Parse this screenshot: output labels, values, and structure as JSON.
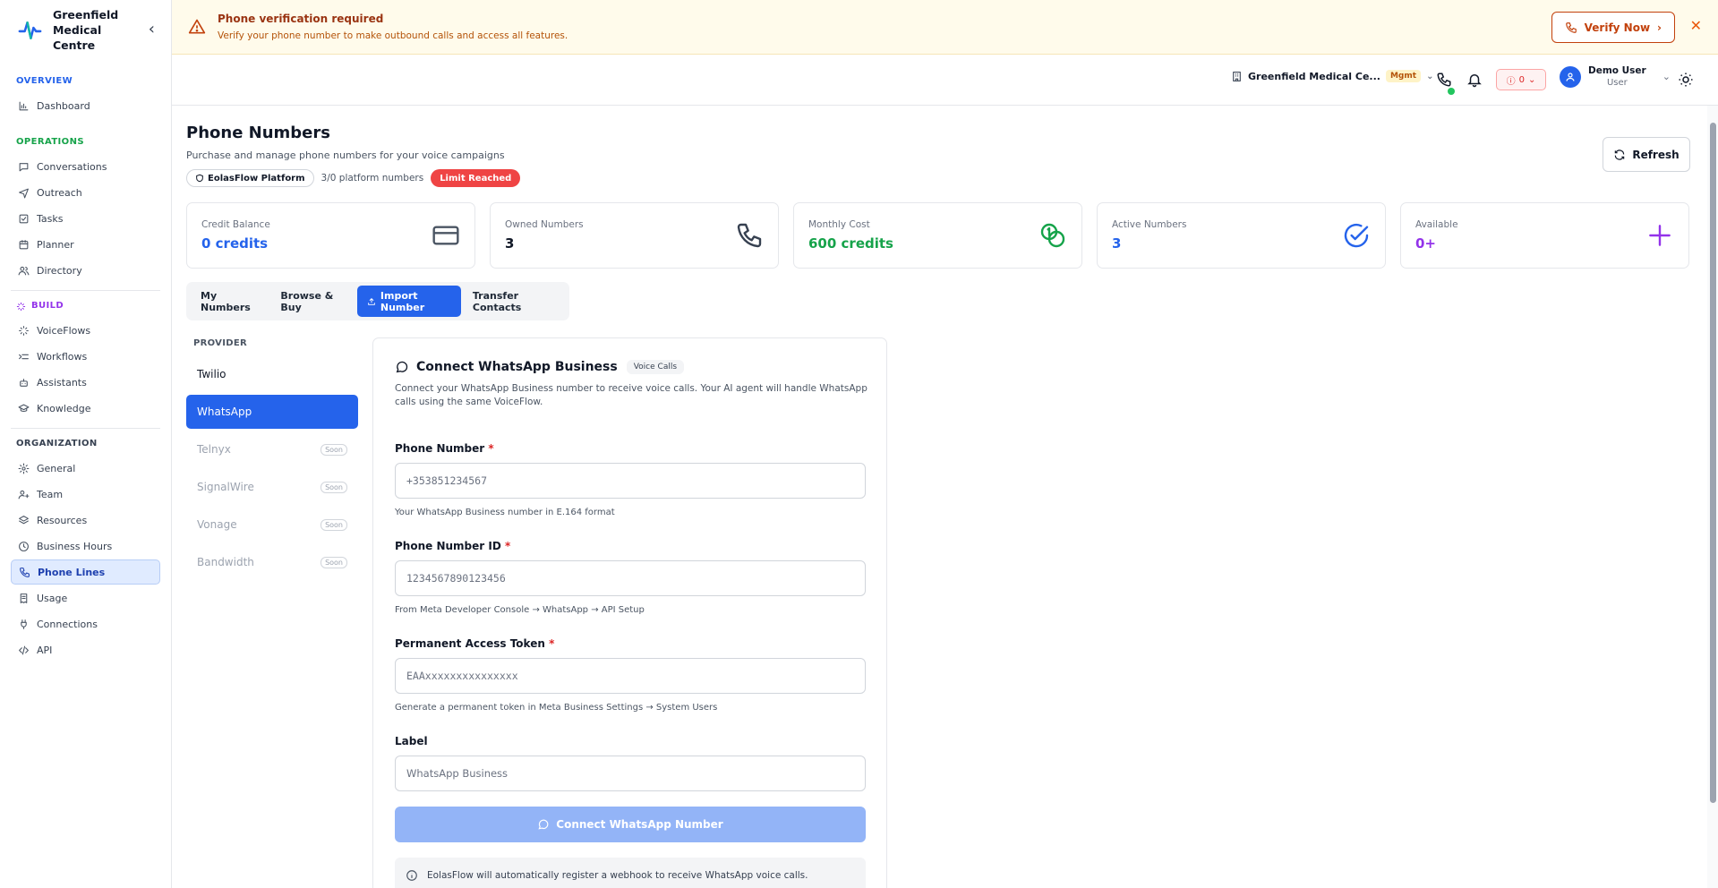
{
  "brand": {
    "name": "Greenfield Medical Centre"
  },
  "sidebar": {
    "sections": [
      {
        "label": "OVERVIEW",
        "color": "#2563eb",
        "items": [
          {
            "label": "Dashboard",
            "icon": "chart-icon"
          }
        ]
      },
      {
        "label": "OPERATIONS",
        "color": "#16a34a",
        "items": [
          {
            "label": "Conversations",
            "icon": "chat-icon"
          },
          {
            "label": "Outreach",
            "icon": "send-icon"
          },
          {
            "label": "Tasks",
            "icon": "checklist-icon"
          },
          {
            "label": "Planner",
            "icon": "calendar-icon"
          },
          {
            "label": "Directory",
            "icon": "users-icon"
          }
        ]
      },
      {
        "label": "BUILD",
        "color": "#9333ea",
        "items": [
          {
            "label": "VoiceFlows",
            "icon": "flow-icon"
          },
          {
            "label": "Workflows",
            "icon": "workflow-icon"
          },
          {
            "label": "Assistants",
            "icon": "bot-icon"
          },
          {
            "label": "Knowledge",
            "icon": "graduation-icon"
          }
        ]
      },
      {
        "label": "ORGANIZATION",
        "color": "#374151",
        "items": [
          {
            "label": "General",
            "icon": "gear-icon"
          },
          {
            "label": "Team",
            "icon": "team-icon"
          },
          {
            "label": "Resources",
            "icon": "layers-icon"
          },
          {
            "label": "Business Hours",
            "icon": "clock-icon"
          },
          {
            "label": "Phone Lines",
            "icon": "phone-icon",
            "active": true
          },
          {
            "label": "Usage",
            "icon": "receipt-icon"
          },
          {
            "label": "Connections",
            "icon": "plug-icon"
          },
          {
            "label": "API",
            "icon": "code-icon"
          }
        ]
      }
    ]
  },
  "banner": {
    "title": "Phone verification required",
    "subtitle": "Verify your phone number to make outbound calls and access all features.",
    "verify_label": "Verify Now"
  },
  "topbar": {
    "org_name": "Greenfield Medical Ce...",
    "org_badge": "Mgmt",
    "error_count": "0",
    "user_name": "Demo User",
    "user_role": "User"
  },
  "page": {
    "title": "Phone Numbers",
    "subtitle": "Purchase and manage phone numbers for your voice campaigns",
    "platform_chip": "EolasFlow Platform",
    "count_chip": "3/0 platform numbers",
    "limit_chip": "Limit Reached",
    "refresh_label": "Refresh"
  },
  "stats": [
    {
      "label": "Credit Balance",
      "value": "0 credits",
      "color": "#2563eb",
      "icon": "credit-card-icon"
    },
    {
      "label": "Owned Numbers",
      "value": "3",
      "color": "#111827",
      "icon": "phone-icon"
    },
    {
      "label": "Monthly Cost",
      "value": "600 credits",
      "color": "#16a34a",
      "icon": "coins-icon"
    },
    {
      "label": "Active Numbers",
      "value": "3",
      "color": "#2563eb",
      "icon": "check-circle-icon"
    },
    {
      "label": "Available",
      "value": "0+",
      "color": "#9333ea",
      "icon": "plus-icon"
    }
  ],
  "tabs": [
    {
      "label": "My Numbers"
    },
    {
      "label": "Browse & Buy"
    },
    {
      "label": "Import Number",
      "active": true
    },
    {
      "label": "Transfer Contacts"
    }
  ],
  "providers": {
    "label": "PROVIDER",
    "items": [
      {
        "name": "Twilio"
      },
      {
        "name": "WhatsApp",
        "active": true
      },
      {
        "name": "Telnyx",
        "soon": "Soon"
      },
      {
        "name": "SignalWire",
        "soon": "Soon"
      },
      {
        "name": "Vonage",
        "soon": "Soon"
      },
      {
        "name": "Bandwidth",
        "soon": "Soon"
      }
    ]
  },
  "form": {
    "title": "Connect WhatsApp Business",
    "badge": "Voice Calls",
    "description": "Connect your WhatsApp Business number to receive voice calls. Your AI agent will handle WhatsApp calls using the same VoiceFlow.",
    "fields": [
      {
        "label": "Phone Number",
        "required": "*",
        "placeholder": "+353851234567",
        "help": "Your WhatsApp Business number in E.164 format"
      },
      {
        "label": "Phone Number ID",
        "required": "*",
        "placeholder": "1234567890123456",
        "help": "From Meta Developer Console → WhatsApp → API Setup"
      },
      {
        "label": "Permanent Access Token",
        "required": "*",
        "placeholder": "EAAxxxxxxxxxxxxxxx",
        "help": "Generate a permanent token in Meta Business Settings → System Users"
      },
      {
        "label": "Label",
        "required": "",
        "placeholder": "WhatsApp Business",
        "help": ""
      }
    ],
    "submit_label": "Connect WhatsApp Number",
    "info": "EolasFlow will automatically register a webhook to receive WhatsApp voice calls."
  }
}
